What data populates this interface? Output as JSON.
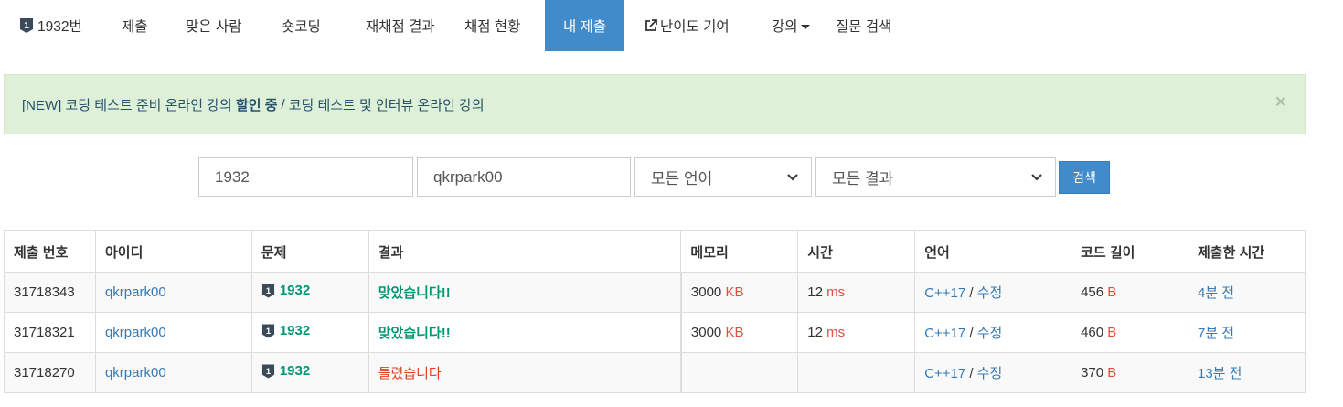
{
  "nav": {
    "tabs": [
      {
        "label": "1932번",
        "icon": "tier-badge-icon"
      },
      {
        "label": "제출"
      },
      {
        "label": "맞은 사람"
      },
      {
        "label": "숏코딩"
      },
      {
        "label": "재채점 결과"
      },
      {
        "label": "채점 현황"
      },
      {
        "label": "내 제출",
        "active": true
      },
      {
        "label": "난이도 기여",
        "icon": "external-link-icon"
      },
      {
        "label": "강의",
        "icon": "caret-down-icon"
      },
      {
        "label": "질문 검색"
      }
    ]
  },
  "alert": {
    "prefix": "[NEW] 코딩 테스트 준비 온라인 강의 ",
    "highlight": "할인 중",
    "separator": "/",
    "second": "코딩 테스트 및 인터뷰 온라인 강의",
    "close": "×"
  },
  "search": {
    "problem_id": "1932",
    "user_id": "qkrpark00",
    "language": "모든 언어",
    "result": "모든 결과",
    "button": "검색"
  },
  "table": {
    "headers": [
      "제출 번호",
      "아이디",
      "문제",
      "결과",
      "메모리",
      "시간",
      "언어",
      "코드 길이",
      "제출한 시간"
    ],
    "rows": [
      {
        "id": "31718343",
        "user": "qkrpark00",
        "problem": "1932",
        "result": "맞았습니다!!",
        "result_type": "ac",
        "memory": "3000",
        "memory_unit": "KB",
        "time": "12",
        "time_unit": "ms",
        "lang": "C++17",
        "lang_sep": "/",
        "edit": "수정",
        "length": "456",
        "length_unit": "B",
        "submitted": "4분 전"
      },
      {
        "id": "31718321",
        "user": "qkrpark00",
        "problem": "1932",
        "result": "맞았습니다!!",
        "result_type": "ac",
        "memory": "3000",
        "memory_unit": "KB",
        "time": "12",
        "time_unit": "ms",
        "lang": "C++17",
        "lang_sep": "/",
        "edit": "수정",
        "length": "460",
        "length_unit": "B",
        "submitted": "7분 전"
      },
      {
        "id": "31718270",
        "user": "qkrpark00",
        "problem": "1932",
        "result": "틀렸습니다",
        "result_type": "wa",
        "memory": "",
        "memory_unit": "",
        "time": "",
        "time_unit": "",
        "lang": "C++17",
        "lang_sep": "/",
        "edit": "수정",
        "length": "370",
        "length_unit": "B",
        "submitted": "13분 전"
      }
    ]
  },
  "colors": {
    "primary": "#428bca",
    "accepted": "#009874",
    "wrong": "#dd4124",
    "unit": "#e74c3c",
    "tier_badge": "#3a4a58"
  }
}
